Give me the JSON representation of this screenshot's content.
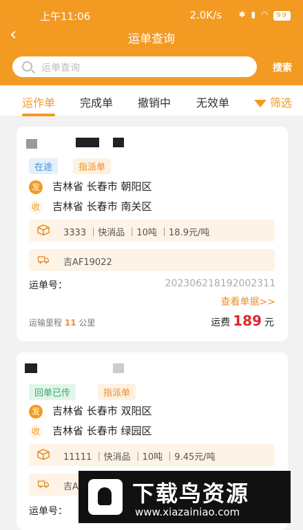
{
  "status_bar": {
    "time": "上午11:06",
    "network": "2.0K/s",
    "battery": "99"
  },
  "nav": {
    "back_icon": "chevron-left-icon",
    "title": "运单查询"
  },
  "search": {
    "placeholder": "运单查询",
    "button": "搜索"
  },
  "tabs": [
    {
      "label": "运作单",
      "active": true
    },
    {
      "label": "完成单",
      "active": false
    },
    {
      "label": "撤销中",
      "active": false
    },
    {
      "label": "无效单",
      "active": false
    }
  ],
  "filter_label": "筛选",
  "orders": [
    {
      "tags": [
        "在途",
        "指派单"
      ],
      "from_icon": "发",
      "from": "吉林省 长春市 朝阳区",
      "to_icon": "收",
      "to": "吉林省 长春市 南关区",
      "goods": "3333 ｜快消品 ｜10吨 ｜18.9元/吨",
      "plate": "吉AF19022",
      "waybill_label": "运单号：",
      "waybill_no": "20230621819200231​1",
      "view_link": "查看单据>>",
      "mileage_label": "运输里程",
      "mileage_value": "11",
      "mileage_unit": "公里",
      "fee_label": "运费",
      "fee_value": "189",
      "fee_unit": "元"
    },
    {
      "tags": [
        "回单已传",
        "指派单"
      ],
      "from_icon": "发",
      "from": "吉林省 长春市 双阳区",
      "to_icon": "收",
      "to": "吉林省 长春市 绿园区",
      "goods": "11111 ｜快消品 ｜10吨 ｜9.45元/吨",
      "plate": "吉A",
      "waybill_label": "运单号："
    }
  ],
  "watermark": {
    "title": "下载鸟资源",
    "url": "www.xiazainiao.com"
  },
  "colors": {
    "brand": "#f39a23",
    "fee": "#e0262d"
  }
}
